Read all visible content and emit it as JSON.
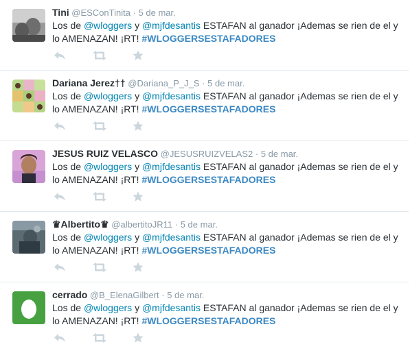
{
  "tweets": [
    {
      "name": "Tini",
      "handle": "@ESConTinita",
      "separator": "·",
      "time": "5 de mar.",
      "text_prefix": "Los de ",
      "mention1": "@wloggers",
      "connector": " y ",
      "mention2": "@mjfdesantis",
      "text_body": "  ESTAFAN al ganador ¡Ademas se rien de el y lo AMENAZAN! ¡RT! ",
      "hashtag": "#WLOGGERSESTAFADORES"
    },
    {
      "name": "Dariana Jerez††",
      "handle": "@Dariana_P_J_S",
      "separator": "·",
      "time": "5 de mar.",
      "text_prefix": "Los de ",
      "mention1": "@wloggers",
      "connector": " y ",
      "mention2": "@mjfdesantis",
      "text_body": "  ESTAFAN al ganador ¡Ademas se rien de el y lo AMENAZAN! ¡RT! ",
      "hashtag": "#WLOGGERSESTAFADORES"
    },
    {
      "name": "JESUS RUIZ VELASCO",
      "handle": "@JESUSRUIZVELAS2",
      "separator": "·",
      "time": "5 de mar.",
      "text_prefix": "Los de ",
      "mention1": "@wloggers",
      "connector": " y ",
      "mention2": "@mjfdesantis",
      "text_body": "  ESTAFAN al ganador ¡Ademas se rien de el y lo AMENAZAN! ¡RT! ",
      "hashtag": "#WLOGGERSESTAFADORES"
    },
    {
      "name": "♛Albertito♛",
      "handle": "@albertitoJR11",
      "separator": "·",
      "time": "5 de mar.",
      "text_prefix": "Los de ",
      "mention1": "@wloggers",
      "connector": " y ",
      "mention2": "@mjfdesantis",
      "text_body": "  ESTAFAN al ganador ¡Ademas se rien de el y lo AMENAZAN! ¡RT! ",
      "hashtag": "#WLOGGERSESTAFADORES"
    },
    {
      "name": "cerrado",
      "handle": "@B_ElenaGilbert",
      "separator": "·",
      "time": "5 de mar.",
      "text_prefix": "Los de ",
      "mention1": "@wloggers",
      "connector": " y ",
      "mention2": "@mjfdesantis",
      "text_body": "  ESTAFAN al ganador ¡Ademas se rien de el y lo AMENAZAN! ¡RT! ",
      "hashtag": "#WLOGGERSESTAFADORES"
    }
  ],
  "icons": {
    "reply": "reply-icon",
    "retweet": "retweet-icon",
    "favorite": "star-icon"
  },
  "colors": {
    "mention": "#0084b4",
    "hashtag": "#3b88c3",
    "action_icon": "#ccd6dd",
    "egg_background": "#47a140"
  }
}
